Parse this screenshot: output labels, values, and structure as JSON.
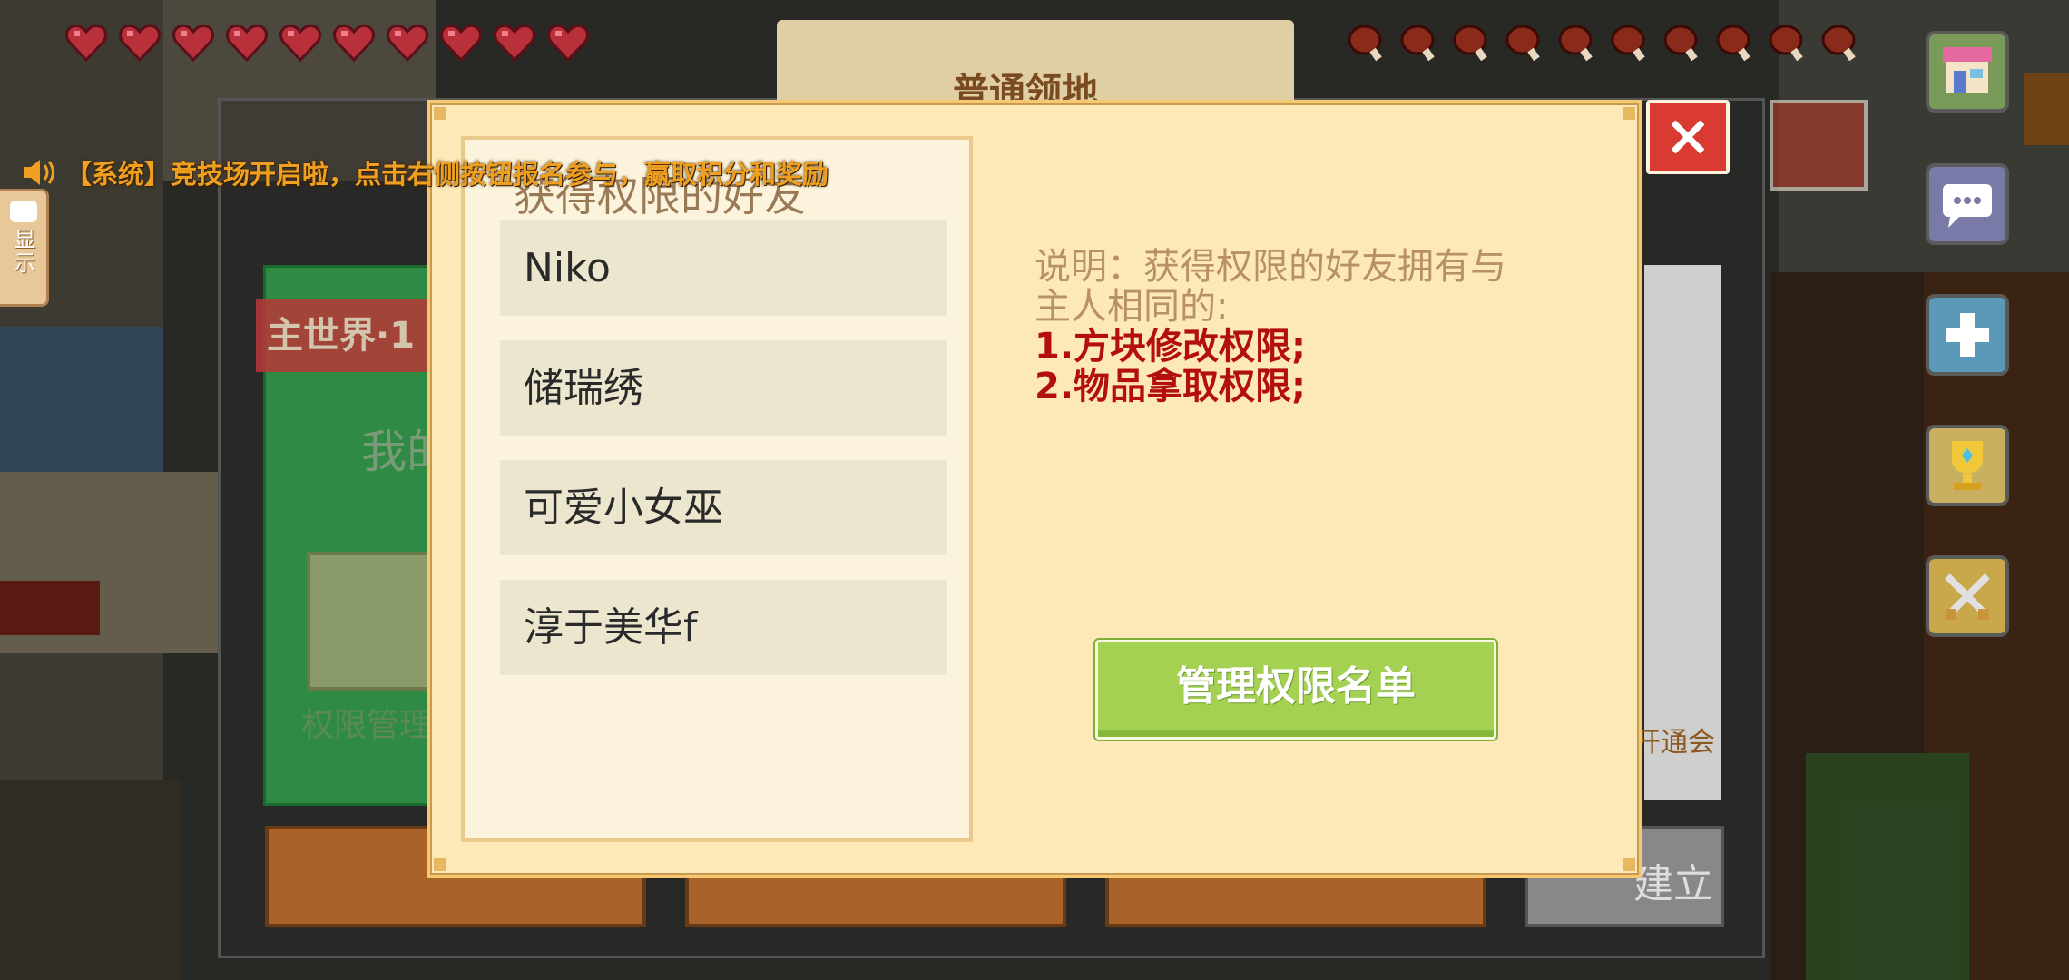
{
  "hud": {
    "hearts": 10,
    "food": 10,
    "notice": "【系统】竞技场开启啦，点击右侧按钮报名参与，赢取积分和奖励",
    "side_tab_label": "显示"
  },
  "background_panel": {
    "title": "普通领地",
    "world_tag": "主世界·1",
    "owner_text": "我的",
    "permission_label": "权限管理",
    "open_text": "开通会",
    "bottom_right_button": "建立"
  },
  "dialog": {
    "list_title": "获得权限的好友",
    "friends": [
      {
        "name": "Niko"
      },
      {
        "name": "储瑞绣"
      },
      {
        "name": "可爱小女巫"
      },
      {
        "name": "淳于美华f"
      }
    ],
    "description": {
      "line1": "说明：获得权限的好友拥有与",
      "line2": "主人相同的:",
      "item1": "1.方块修改权限;",
      "item2": "2.物品拿取权限;"
    },
    "manage_button": "管理权限名单"
  },
  "colors": {
    "dialog_bg": "#fde9b8",
    "manage_button": "#a5d153",
    "close_button": "#d93a32",
    "red_text": "#b30f0f"
  },
  "icons": [
    "heart-icon",
    "meat-icon",
    "speaker-icon",
    "close-icon",
    "shop-icon",
    "chat-icon",
    "plus-icon",
    "trophy-icon",
    "swords-icon"
  ]
}
